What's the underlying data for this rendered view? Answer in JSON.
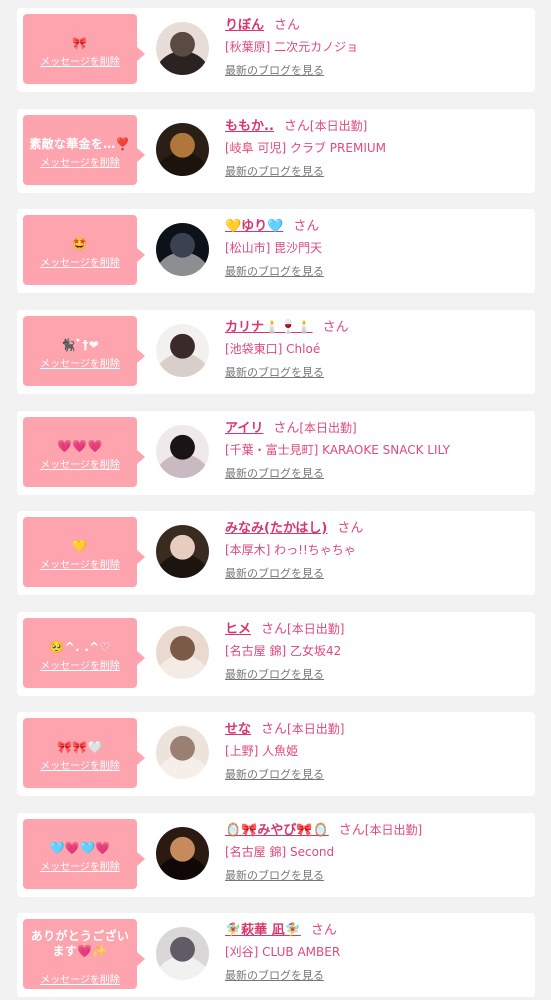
{
  "delete_label": "メッセージを削除",
  "blog_label": "最新のブログを見る",
  "san_label": "さん",
  "cards": [
    {
      "message": "🎀",
      "name": "りぼん",
      "working": "",
      "store": "[秋葉原] 二次元カノジョ",
      "avatar_colors": [
        "#e7dcd6",
        "#5b4a44",
        "#2b2222"
      ]
    },
    {
      "message": "素敵な華金を…❣️",
      "name": "ももか..",
      "working": "[本日出勤]",
      "store": "[岐阜 可児] クラブ PREMIUM",
      "avatar_colors": [
        "#2a1f14",
        "#b0763c",
        "#1b130c"
      ]
    },
    {
      "message": "🤩",
      "name": "💛ゆり🩵",
      "working": "",
      "store": "[松山市] 毘沙門天",
      "avatar_colors": [
        "#0d1118",
        "#3a4150",
        "#8b8f92"
      ]
    },
    {
      "message": "🐈‍⬛ﾞ†❤",
      "name": "カリナ🕯️🍷🕯️",
      "working": "",
      "store": "[池袋東口] Chloé",
      "avatar_colors": [
        "#f3f1f0",
        "#3a2a2a",
        "#d8cfcb"
      ]
    },
    {
      "message": "💗💗💗",
      "name": "アイリ",
      "working": "[本日出勤]",
      "store": "[千葉・富士見町] KARAOKE SNACK LILY",
      "avatar_colors": [
        "#efe9ec",
        "#1b1417",
        "#c9b9c0"
      ]
    },
    {
      "message": "💛",
      "name": "みなみ(たかはし)",
      "working": "",
      "store": "[本厚木] わっ!!ちゃちゃ",
      "avatar_colors": [
        "#3a2b20",
        "#e6cdbf",
        "#1c140f"
      ]
    },
    {
      "message": "🥺^. .^♡",
      "name": "ヒメ",
      "working": "[本日出勤]",
      "store": "[名古屋 錦] 乙女坂42",
      "avatar_colors": [
        "#e9d9cf",
        "#7b5a48",
        "#f4ebe5"
      ]
    },
    {
      "message": "🎀🎀🤍",
      "name": "せな",
      "working": "[本日出勤]",
      "store": "[上野] 人魚姫",
      "avatar_colors": [
        "#ece3dc",
        "#9a8073",
        "#f6efe9"
      ]
    },
    {
      "message": "🩵💗🩵💗",
      "name": "🪞🎀みやび🎀🪞",
      "working": "[本日出勤]",
      "store": "[名古屋 錦] Second",
      "avatar_colors": [
        "#2b1a12",
        "#c68b5c",
        "#0f0806"
      ]
    },
    {
      "message": "ありがとうございます💗✨",
      "name": "🧚‍♀️萩華 凪🧚‍♀️",
      "working": "",
      "store": "[刈谷] CLUB AMBER",
      "avatar_colors": [
        "#d9d7d8",
        "#5f5c66",
        "#f2f1f1"
      ]
    }
  ]
}
